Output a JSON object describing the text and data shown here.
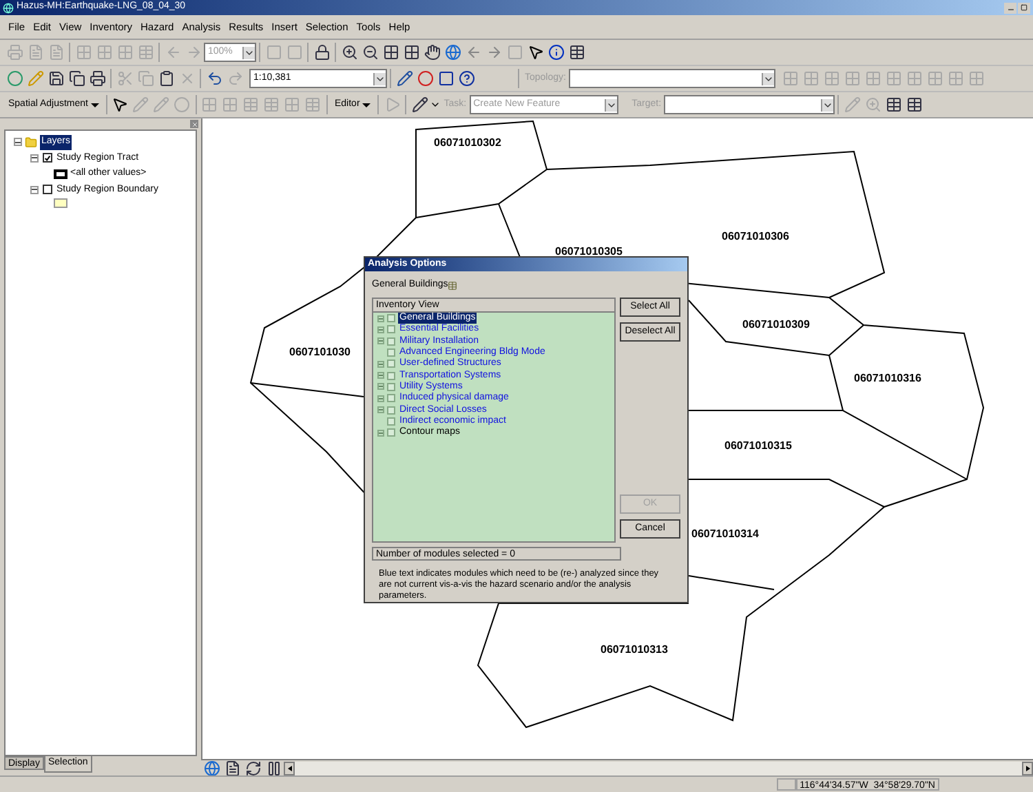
{
  "window": {
    "title": "Hazus-MH:Earthquake-LNG_08_04_30"
  },
  "menu": [
    "File",
    "Edit",
    "View",
    "Inventory",
    "Hazard",
    "Analysis",
    "Results",
    "Insert",
    "Selection",
    "Tools",
    "Help"
  ],
  "toolbars": {
    "zoom_combo": "100%",
    "scale": "1:10,381",
    "topology_label": "Topology:",
    "spatial_adjustment": "Spatial Adjustment",
    "editor": "Editor",
    "task_label": "Task:",
    "task": "Create New Feature",
    "target_label": "Target:"
  },
  "table_of_contents": {
    "root": "Layers",
    "root_selected": true,
    "layers": [
      {
        "name": "Study Region Tract",
        "checked": true,
        "kind": "outline",
        "legend": "<all other values>"
      },
      {
        "name": "Study Region Boundary",
        "checked": false,
        "kind": "fill"
      }
    ]
  },
  "toc_tabs": [
    {
      "label": "Display",
      "selected": false
    },
    {
      "label": "Selection",
      "selected": true
    }
  ],
  "map": {
    "tract_labels": [
      "06071010302",
      "06071010305",
      "06071010306",
      "0607101030",
      "06071010309",
      "06071010316",
      "06071010315",
      "06071010314",
      "06071010313"
    ]
  },
  "dialog": {
    "title": "Analysis Options",
    "subtitle": "General Buildings",
    "tree_header": "Inventory View",
    "items": [
      {
        "label": "General Buildings",
        "needs_analysis": true,
        "expandable": true,
        "checked": false,
        "selected": true
      },
      {
        "label": "Essential Facilities",
        "needs_analysis": true,
        "expandable": true,
        "checked": false,
        "selected": false
      },
      {
        "label": "Military Installation",
        "needs_analysis": true,
        "expandable": true,
        "checked": false,
        "selected": false
      },
      {
        "label": "Advanced Engineering Bldg Mode",
        "needs_analysis": true,
        "expandable": false,
        "checked": false,
        "selected": false
      },
      {
        "label": "User-defined Structures",
        "needs_analysis": true,
        "expandable": true,
        "checked": false,
        "selected": false
      },
      {
        "label": "Transportation Systems",
        "needs_analysis": true,
        "expandable": true,
        "checked": false,
        "selected": false
      },
      {
        "label": "Utility Systems",
        "needs_analysis": true,
        "expandable": true,
        "checked": false,
        "selected": false
      },
      {
        "label": "Induced physical damage",
        "needs_analysis": true,
        "expandable": true,
        "checked": false,
        "selected": false
      },
      {
        "label": "Direct Social Losses",
        "needs_analysis": true,
        "expandable": true,
        "checked": false,
        "selected": false
      },
      {
        "label": "Indirect economic impact",
        "needs_analysis": true,
        "expandable": false,
        "checked": false,
        "selected": false
      },
      {
        "label": "Contour maps",
        "needs_analysis": false,
        "expandable": true,
        "checked": false,
        "selected": false
      }
    ],
    "buttons": [
      {
        "label": "Select All",
        "disabled": false
      },
      {
        "label": "Deselect All",
        "disabled": false
      },
      {
        "label": "OK",
        "disabled": true
      },
      {
        "label": "Cancel",
        "disabled": false
      }
    ],
    "status": "Number of modules selected = 0",
    "note": "Blue text indicates modules which need to be (re-) analyzed since they are not current vis-a-vis the hazard scenario and/or the analysis parameters."
  },
  "status_bar": {
    "coordinates": "116°44'34.57\"W  34°58'29.70\"N"
  }
}
